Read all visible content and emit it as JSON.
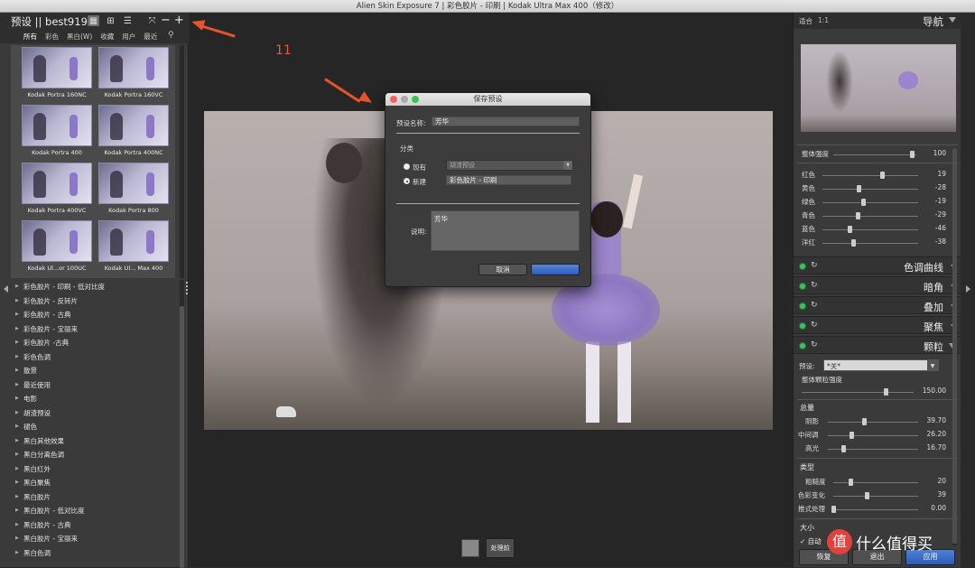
{
  "window": {
    "title": "Alien Skin Exposure 7 | 彩色胶片 - 印刷 | Kodak Ultra Max 400（修改）"
  },
  "left": {
    "title": "预设 || best919",
    "filters": [
      "所有",
      "彩色",
      "黑白(W)",
      "收藏",
      "用户",
      "最近"
    ],
    "thumbs": [
      "Kodak Portra 160NC",
      "Kodak Portra 160VC",
      "Kodak Portra 400",
      "Kodak Portra 400NC",
      "Kodak Portra 400VC",
      "Kodak Portra 800",
      "Kodak Ul...or 100UC",
      "Kodak Ul... Max 400"
    ],
    "list": [
      "彩色胶片 - 印刷 - 低对比度",
      "彩色胶片 - 反转片",
      "彩色胶片 - 古典",
      "彩色胶片 - 宝丽来",
      "彩色胶片 -古典",
      "彩色色调",
      "散景",
      "最近使用",
      "电影",
      "胡渣预设",
      "褪色",
      "黑白其他效果",
      "黑白分离色调",
      "黑白红外",
      "黑白聚焦",
      "黑白胶片",
      "黑白胶片 - 低对比度",
      "黑白胶片 - 古典",
      "黑白胶片 - 宝丽来",
      "黑白色调"
    ]
  },
  "annotation": {
    "number": "11"
  },
  "dialog": {
    "title": "保存预设",
    "name_label": "预设名称:",
    "name_value": "芳华",
    "category_label": "分类",
    "existing_label": "现有",
    "existing_value": "胡渣预设",
    "new_label": "新建",
    "new_value": "彩色胶片 - 印刷",
    "desc_label": "说明:",
    "desc_value": "芳华",
    "cancel": "取消",
    "ok": ""
  },
  "center": {
    "process_before": "处理前"
  },
  "right": {
    "fit": "适合",
    "oneone": "1:1",
    "nav_title": "导航",
    "overall_label": "整体强度",
    "overall_value": "100",
    "overall_level": 0.95,
    "hsl": [
      {
        "label": "红色",
        "value": "19",
        "level": 0.62
      },
      {
        "label": "黄色",
        "value": "-28",
        "level": 0.38
      },
      {
        "label": "绿色",
        "value": "-19",
        "level": 0.42
      },
      {
        "label": "青色",
        "value": "-29",
        "level": 0.37
      },
      {
        "label": "蓝色",
        "value": "-46",
        "level": 0.28
      },
      {
        "label": "洋红",
        "value": "-38",
        "level": 0.32
      }
    ],
    "sections": [
      "色调曲线",
      "暗角",
      "叠加",
      "聚焦",
      "颗粒"
    ],
    "grain": {
      "preset_label": "预设:",
      "preset_value": "*关*",
      "overall_label": "整体颗粒强度",
      "overall_value": "150.00",
      "overall_level": 0.75,
      "amount_label": "总量",
      "amount": [
        {
          "label": "阴影",
          "value": "39.70",
          "level": 0.4
        },
        {
          "label": "中间调",
          "value": "26.20",
          "level": 0.26
        },
        {
          "label": "高光",
          "value": "16.70",
          "level": 0.17
        }
      ],
      "type_label": "类型",
      "type": [
        {
          "label": "粗糙度",
          "value": "20",
          "level": 0.2
        },
        {
          "label": "色彩变化",
          "value": "39",
          "level": 0.39
        },
        {
          "label": "推式处理",
          "value": "0.00",
          "level": 0.0
        }
      ],
      "size_label": "大小",
      "auto_label": "✓ 自动"
    },
    "buttons": {
      "restore": "恢复",
      "exit": "退出",
      "apply": "应用"
    }
  },
  "watermark": {
    "logo": "值",
    "text": "什么值得买"
  }
}
